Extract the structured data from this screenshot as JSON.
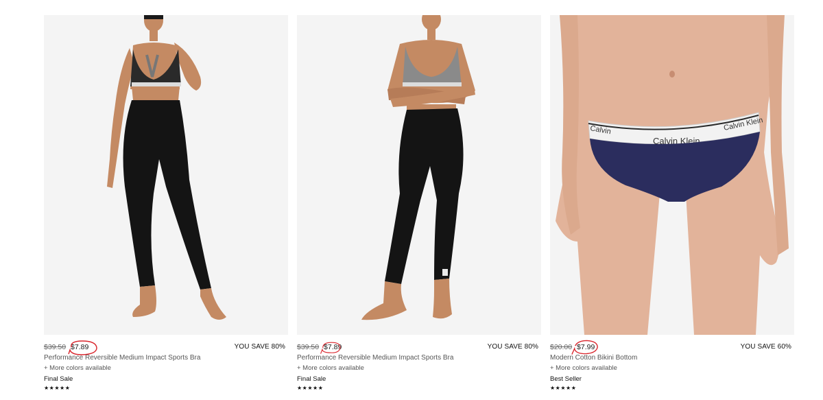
{
  "products": [
    {
      "image_alt": "Performance Reversible Medium Impact Sports Bra",
      "original_price": "$39.50",
      "sale_price": "$7.89",
      "savings": "YOU SAVE 80%",
      "name": "Performance Reversible Medium Impact Sports Bra",
      "more_colors": "+ More colors available",
      "badge": "Final Sale",
      "rating": "★★★★★"
    },
    {
      "image_alt": "Performance Reversible Medium Impact Sports Bra",
      "original_price": "$39.50",
      "sale_price": "$7.89",
      "savings": "YOU SAVE 80%",
      "name": "Performance Reversible Medium Impact Sports Bra",
      "more_colors": "+ More colors available",
      "badge": "Final Sale",
      "rating": "★★★★★"
    },
    {
      "image_alt": "Modern Cotton Bikini Bottom",
      "original_price": "$20.00",
      "sale_price": "$7.99",
      "savings": "YOU SAVE 60%",
      "name": "Modern Cotton Bikini Bottom",
      "more_colors": "+ More colors available",
      "badge": "Best Seller",
      "rating": "★★★★★"
    }
  ],
  "colors": {
    "annotation_circle": "#d9232a",
    "image_background": "#f4f4f4",
    "bikini_navy": "#2b2d5e",
    "waistband": "#f2f2f2"
  }
}
